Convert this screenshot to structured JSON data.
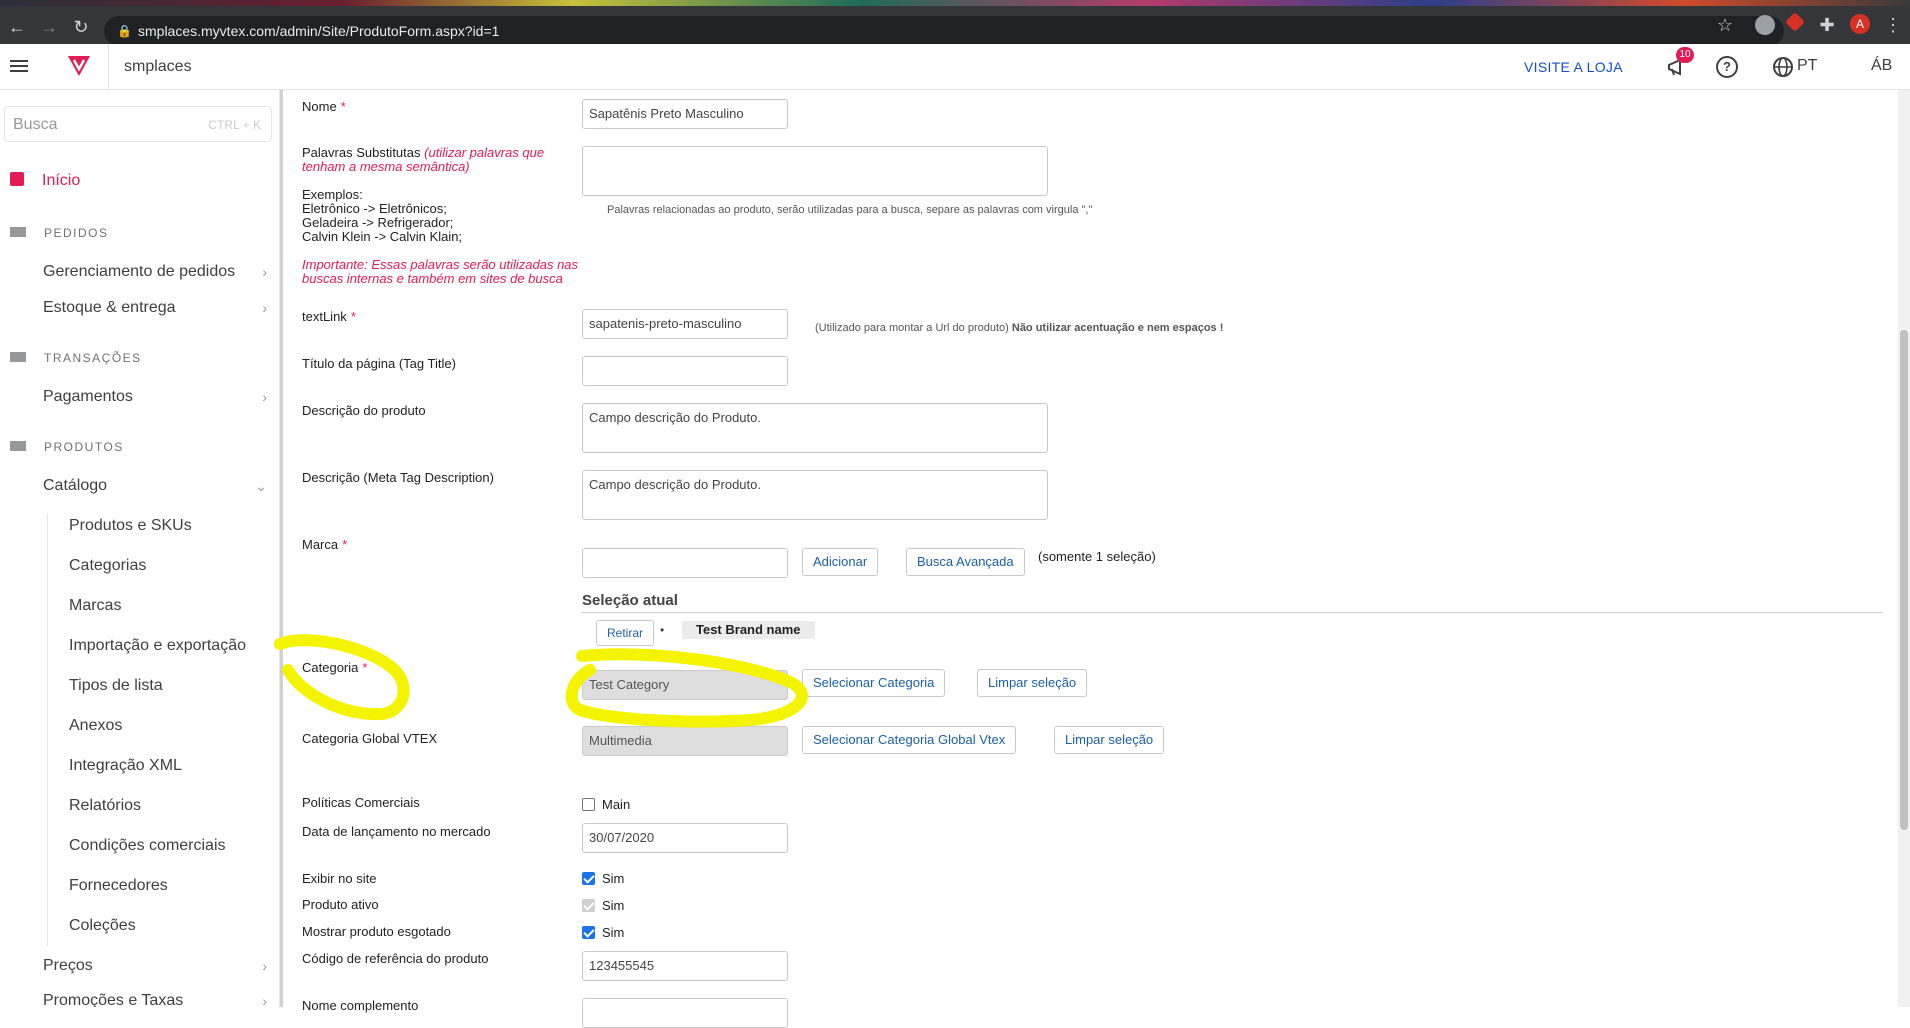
{
  "browser": {
    "url": "smplaces.myvtex.com/admin/Site/ProdutoForm.aspx?id=1",
    "profile_initial": "A"
  },
  "header": {
    "store_name": "smplaces",
    "visit_store": "VISITE A LOJA",
    "notification_count": "10",
    "language": "PT",
    "user": "ÁB"
  },
  "sidebar": {
    "search_placeholder": "Busca",
    "search_shortcut": "CTRL + K",
    "home": "Início",
    "sections": [
      {
        "title": "PEDIDOS",
        "items": [
          "Gerenciamento de pedidos",
          "Estoque & entrega"
        ]
      },
      {
        "title": "TRANSAÇÕES",
        "items": [
          "Pagamentos"
        ]
      },
      {
        "title": "PRODUTOS",
        "items": [
          "Catálogo"
        ]
      }
    ],
    "catalog_subitems": [
      "Produtos e SKUs",
      "Categorias",
      "Marcas",
      "Importação e exportação",
      "Tipos de lista",
      "Anexos",
      "Integração XML",
      "Relatórios",
      "Condições comerciais",
      "Fornecedores",
      "Coleções"
    ],
    "more_items": [
      "Preços",
      "Promoções e Taxas"
    ]
  },
  "form": {
    "nome": {
      "label": "Nome",
      "value": "Sapatênis Preto Masculino"
    },
    "substitutas": {
      "label": "Palavras Substitutas",
      "label_note": "(utilizar palavras que tenham a mesma semântica)",
      "examples_title": "Exemplos:",
      "examples": [
        "Eletrônico -> Eletrônicos;",
        "Geladeira -> Refrigerador;",
        "Calvin Klein -> Calvin Klain;"
      ],
      "important": "Importante: Essas palavras serão utilizadas nas buscas internas e também em sites de busca",
      "value": "",
      "hint": "Palavras relacionadas ao produto, serão utilizadas para a busca, separe as palavras com virgula \",\""
    },
    "textlink": {
      "label": "textLink",
      "value": "sapatenis-preto-masculino",
      "hint": "(Utilizado para montar a Url do produto)",
      "hint_bold": "Não utilizar acentuação e nem espaços !"
    },
    "titulo": {
      "label": "Título da página (Tag Title)",
      "value": ""
    },
    "descricao": {
      "label": "Descrição do produto",
      "value": "Campo descrição do Produto."
    },
    "meta_descricao": {
      "label": "Descrição (Meta Tag Description)",
      "value": "Campo descrição do Produto."
    },
    "marca": {
      "label": "Marca",
      "value": "",
      "add": "Adicionar",
      "advanced": "Busca Avançada",
      "note": "(somente 1 seleção)",
      "selection_title": "Seleção atual",
      "remove": "Retirar",
      "bullet": "•",
      "selected": "Test Brand name"
    },
    "categoria": {
      "label": "Categoria",
      "value": "Test Category",
      "select": "Selecionar Categoria",
      "clear": "Limpar seleção"
    },
    "categoria_global": {
      "label": "Categoria Global VTEX",
      "value": "Multimedia",
      "select": "Selecionar Categoria Global Vtex",
      "clear": "Limpar seleção"
    },
    "politicas": {
      "label": "Políticas Comerciais",
      "option": "Main",
      "checked": false
    },
    "data_lancamento": {
      "label": "Data de lançamento no mercado",
      "value": "30/07/2020"
    },
    "exibir": {
      "label": "Exibir no site",
      "option": "Sim",
      "checked": true
    },
    "ativo": {
      "label": "Produto ativo",
      "option": "Sim",
      "checked": true,
      "disabled": true
    },
    "esgotado": {
      "label": "Mostrar produto esgotado",
      "option": "Sim",
      "checked": true
    },
    "referencia": {
      "label": "Código de referência do produto",
      "value": "123455545"
    },
    "complemento": {
      "label": "Nome complemento",
      "value": ""
    }
  },
  "colors": {
    "accent": "#e31b54",
    "link": "#134cd8",
    "highlight": "#f4f400"
  }
}
